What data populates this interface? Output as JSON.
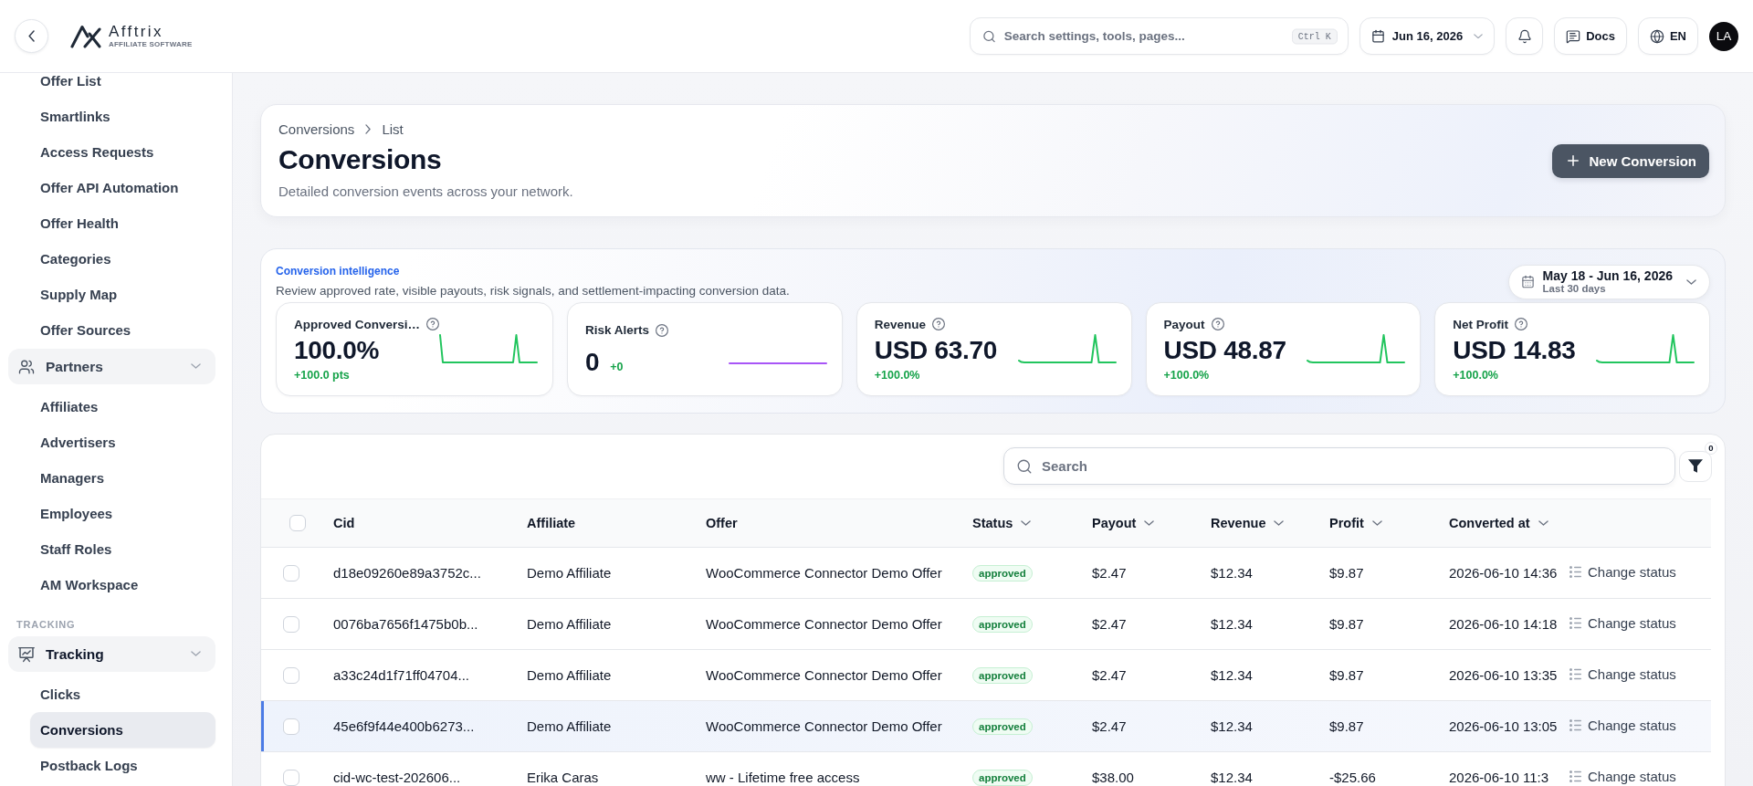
{
  "topbar": {
    "logo": {
      "name": "Afftrix",
      "tagline": "AFFILIATE SOFTWARE"
    },
    "search": {
      "placeholder": "Search settings, tools, pages...",
      "shortcut": "Ctrl K"
    },
    "date": "Jun 16, 2026",
    "docs": "Docs",
    "language": "EN",
    "avatar": "LA"
  },
  "sidebar": {
    "items": [
      {
        "kind": "link",
        "label": "Offer List",
        "selected": false
      },
      {
        "kind": "link",
        "label": "Smartlinks",
        "selected": false
      },
      {
        "kind": "link",
        "label": "Access Requests",
        "selected": false
      },
      {
        "kind": "link",
        "label": "Offer API Automation",
        "selected": false
      },
      {
        "kind": "link",
        "label": "Offer Health",
        "selected": false
      },
      {
        "kind": "link",
        "label": "Categories",
        "selected": false
      },
      {
        "kind": "link",
        "label": "Supply Map",
        "selected": false
      },
      {
        "kind": "link",
        "label": "Offer Sources",
        "selected": false
      },
      {
        "kind": "group",
        "label": "Partners",
        "expanded": true,
        "children": [
          {
            "label": "Affiliates",
            "selected": false
          },
          {
            "label": "Advertisers",
            "selected": false
          },
          {
            "label": "Managers",
            "selected": false
          },
          {
            "label": "Employees",
            "selected": false
          },
          {
            "label": "Staff Roles",
            "selected": false
          },
          {
            "label": "AM Workspace",
            "selected": false
          }
        ]
      },
      {
        "kind": "section",
        "label": "TRACKING"
      },
      {
        "kind": "group",
        "label": "Tracking",
        "expanded": true,
        "children": [
          {
            "label": "Clicks",
            "selected": false
          },
          {
            "label": "Conversions",
            "selected": true
          },
          {
            "label": "Postback Logs",
            "selected": false
          }
        ]
      }
    ]
  },
  "header": {
    "breadcrumb": [
      "Conversions",
      "List"
    ],
    "title": "Conversions",
    "subtitle": "Detailed conversion events across your network.",
    "action": "New Conversion"
  },
  "intelligence": {
    "title": "Conversion intelligence",
    "description": "Review approved rate, visible payouts, risk signals, and settlement-impacting conversion data.",
    "range": {
      "label": "May 18 - Jun 16, 2026",
      "sublabel": "Last 30 days"
    },
    "kpis": [
      {
        "kind": "rate",
        "label": "Approved Conversi…",
        "value": "100.0%",
        "change": "+100.0 pts"
      },
      {
        "kind": "alert",
        "label": "Risk Alerts",
        "value": "0",
        "change": "+0"
      },
      {
        "kind": "amount",
        "label": "Revenue",
        "value": "USD 63.70",
        "change": "+100.0%"
      },
      {
        "kind": "amount",
        "label": "Payout",
        "value": "USD 48.87",
        "change": "+100.0%"
      },
      {
        "kind": "amount",
        "label": "Net Profit",
        "value": "USD 14.83",
        "change": "+100.0%"
      }
    ]
  },
  "table": {
    "search": {
      "placeholder": "Search"
    },
    "filter_count": "0",
    "all_checked": false,
    "columns": [
      {
        "label": "Cid",
        "sortable": false
      },
      {
        "label": "Affiliate",
        "sortable": false
      },
      {
        "label": "Offer",
        "sortable": false
      },
      {
        "label": "Status",
        "sortable": true
      },
      {
        "label": "Payout",
        "sortable": true
      },
      {
        "label": "Revenue",
        "sortable": true
      },
      {
        "label": "Profit",
        "sortable": true
      },
      {
        "label": "Converted at",
        "sortable": true
      }
    ],
    "rows": [
      {
        "cid": "d18e09260e89a3752c...",
        "affiliate": "Demo Affiliate",
        "offer": "WooCommerce Connector Demo Offer",
        "status": "approved",
        "payout": "$2.47",
        "revenue": "$12.34",
        "profit": "$9.87",
        "converted_at": "2026-06-10 14:36",
        "action": "Change status",
        "checked": false,
        "selected": false
      },
      {
        "cid": "0076ba7656f1475b0b...",
        "affiliate": "Demo Affiliate",
        "offer": "WooCommerce Connector Demo Offer",
        "status": "approved",
        "payout": "$2.47",
        "revenue": "$12.34",
        "profit": "$9.87",
        "converted_at": "2026-06-10 14:18",
        "action": "Change status",
        "checked": false,
        "selected": false
      },
      {
        "cid": "a33c24d1f71ff04704...",
        "affiliate": "Demo Affiliate",
        "offer": "WooCommerce Connector Demo Offer",
        "status": "approved",
        "payout": "$2.47",
        "revenue": "$12.34",
        "profit": "$9.87",
        "converted_at": "2026-06-10 13:35",
        "action": "Change status",
        "checked": false,
        "selected": false
      },
      {
        "cid": "45e6f9f44e400b6273...",
        "affiliate": "Demo Affiliate",
        "offer": "WooCommerce Connector Demo Offer",
        "status": "approved",
        "payout": "$2.47",
        "revenue": "$12.34",
        "profit": "$9.87",
        "converted_at": "2026-06-10 13:05",
        "action": "Change status",
        "checked": false,
        "selected": true
      },
      {
        "cid": "cid-wc-test-202606...",
        "affiliate": "Erika Caras",
        "offer": "ww - Lifetime free access",
        "status": "approved",
        "payout": "$38.00",
        "revenue": "$12.34",
        "profit": "-$25.66",
        "converted_at": "2026-06-10 11:3",
        "action": "Change status",
        "checked": false,
        "selected": false
      }
    ]
  }
}
